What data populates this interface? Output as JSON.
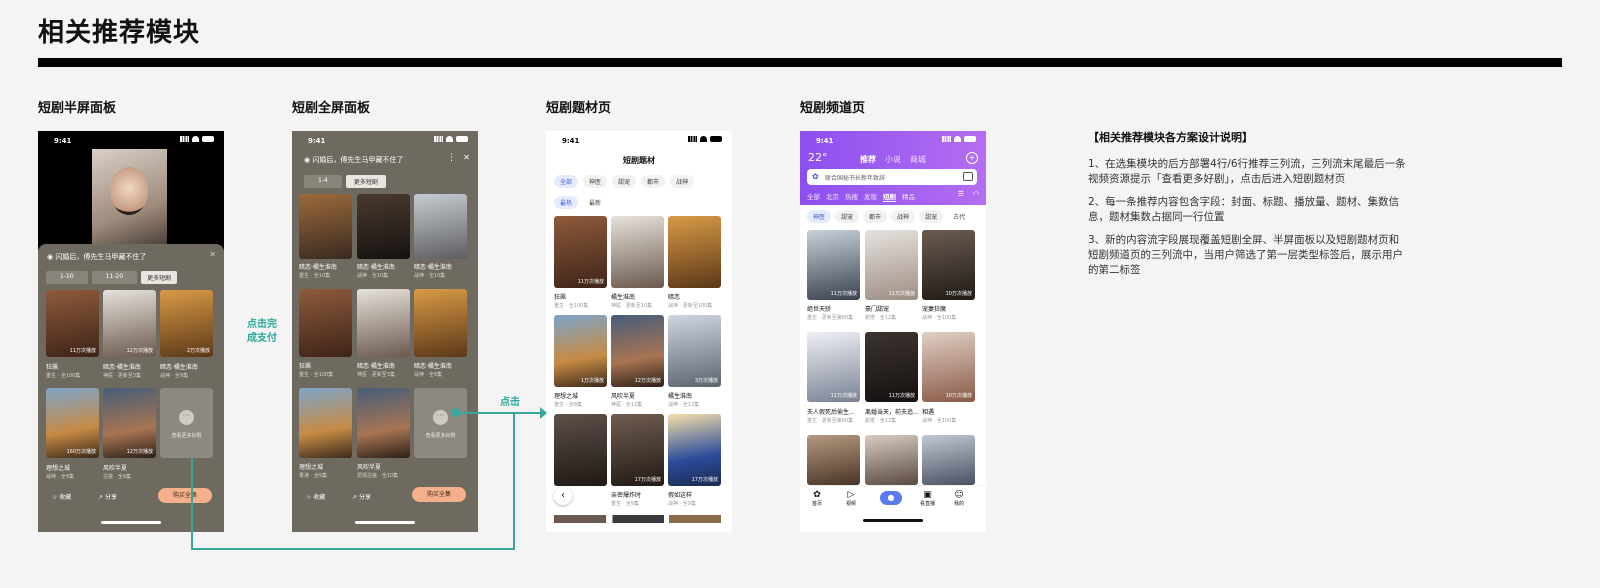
{
  "page_title": "相关推荐模块",
  "sections": [
    "短剧半屏面板",
    "短剧全屏面板",
    "短剧题材页",
    "短剧频道页"
  ],
  "status_time": "9:41",
  "drama_title": "闪婚后，傅先生马甲藏不住了",
  "half_panel": {
    "tabs": [
      "1-10",
      "11-20",
      "更多短剧"
    ],
    "items": [
      {
        "title": "狂飙",
        "meta": "重生 · 全100集",
        "count": "11万次播放"
      },
      {
        "title": "暗恋·橘生淮南",
        "meta": "神医 · 更新至3集",
        "count": "12万次播放"
      },
      {
        "title": "暗恋·橘生淮南",
        "meta": "战神 · 全9集",
        "count": "2万次播放"
      },
      {
        "title": "理想之城",
        "meta": "战神 · 全9集",
        "count": "160万次播放"
      },
      {
        "title": "风吹半夏",
        "meta": "古装 · 全9集",
        "count": "12万次播放"
      }
    ],
    "more_label": "查看更多好剧",
    "fav_label": "收藏",
    "share_label": "分享",
    "buy_label": "购买全集"
  },
  "full_panel": {
    "tabs": [
      "1-4",
      "更多短剧"
    ],
    "items": [
      {
        "title": "暗恋·橘生淮南",
        "meta": "重生 · 全10集"
      },
      {
        "title": "暗恋·橘生淮南",
        "meta": "战神 · 全10集"
      },
      {
        "title": "暗恋·橘生淮南",
        "meta": "战神 · 全10集"
      },
      {
        "title": "狂飙",
        "meta": "重生 · 全100集"
      },
      {
        "title": "暗恋·橘生淮南",
        "meta": "神医 · 更新至3集"
      },
      {
        "title": "暗恋·橘生淮南",
        "meta": "战神 · 全9集"
      },
      {
        "title": "理想之城",
        "meta": "香港 · 全9集"
      },
      {
        "title": "风吹半夏",
        "meta": "爱情古装 · 全10集"
      }
    ],
    "more_label": "查看更多好剧",
    "fav_label": "收藏",
    "share_label": "分享",
    "buy_label": "购买全集"
  },
  "topic_page": {
    "title": "短剧题材",
    "chips": [
      "全部",
      "神医",
      "甜宠",
      "都市",
      "战神"
    ],
    "subchips": [
      "最热",
      "最新"
    ],
    "items": [
      {
        "title": "狂飙",
        "meta": "重生 · 全100集",
        "count": "11万次播放"
      },
      {
        "title": "橘生淮南",
        "meta": "神医 · 更新至10集",
        "count": ""
      },
      {
        "title": "暗恋",
        "meta": "战神 · 更新至100集",
        "count": ""
      },
      {
        "title": "理想之城",
        "meta": "重生 · 全9集",
        "count": "1万次播放"
      },
      {
        "title": "风吹半夏",
        "meta": "神医 · 全12集",
        "count": "12万次播放"
      },
      {
        "title": "橘生淮南",
        "meta": "战神 · 全12集",
        "count": "3万次播放"
      },
      {
        "title": "",
        "meta": "",
        "count": ""
      },
      {
        "title": "亲密爆炸时",
        "meta": "重生 · 全9集",
        "count": "17万次播放"
      },
      {
        "title": "假如这样",
        "meta": "战神 · 全9集",
        "count": "17万次播放"
      }
    ]
  },
  "channel_page": {
    "weather": "22°",
    "tabs": [
      "推荐",
      "小说",
      "商城"
    ],
    "search_placeholder": "联合国秘书长新年致辞",
    "nav": [
      "全部",
      "北京",
      "热搜",
      "发现",
      "短剧",
      "精品"
    ],
    "chips": [
      "神医",
      "甜宠",
      "都市",
      "战神",
      "甜宠",
      "古代"
    ],
    "items": [
      {
        "title": "绝世天骄",
        "meta": "重生 · 更新至第80集",
        "count": "11万次播放"
      },
      {
        "title": "豪门甜宠",
        "meta": "甜宠 · 全12集",
        "count": "11万次播放"
      },
      {
        "title": "宠妻狂魔",
        "meta": "战神 · 全100集",
        "count": "10万次播放"
      },
      {
        "title": "夫人假死后偷生...",
        "meta": "重生 · 更新至第80集",
        "count": "11万次播放"
      },
      {
        "title": "离婚当天，前夫追...",
        "meta": "甜宠 · 全12集",
        "count": "11万次播放"
      },
      {
        "title": "相遇",
        "meta": "战神 · 全100集",
        "count": "10万次播放"
      },
      {
        "title": "",
        "meta": "",
        "count": ""
      },
      {
        "title": "",
        "meta": "",
        "count": ""
      },
      {
        "title": "",
        "meta": "",
        "count": ""
      }
    ],
    "bottom_tabs": [
      "首页",
      "视频",
      "",
      "看直播",
      "我的"
    ]
  },
  "hints": {
    "pay": "点击完成支付",
    "click": "点击"
  },
  "notes": {
    "title": "【相关推荐模块各方案设计说明】",
    "items": [
      "1、在选集模块的后方部署4行/6行推荐三列流，三列流末尾最后一条视频资源提示「查看更多好剧」，点击后进入短剧题材页",
      "2、每一条推荐内容包含字段：封面、标题、播放量、题材、集数信息，题材集数占据同一行位置",
      "3、新的内容流字段展现覆盖短剧全屏、半屏面板以及短剧题材页和短剧频道页的三列流中，当用户筛选了第一层类型标签后，展示用户的第二标签"
    ]
  },
  "colors": {
    "accent": "#27a89a",
    "panel": "#6f6a60",
    "channel": "#8b55ef",
    "buy": "#f3b08a"
  }
}
